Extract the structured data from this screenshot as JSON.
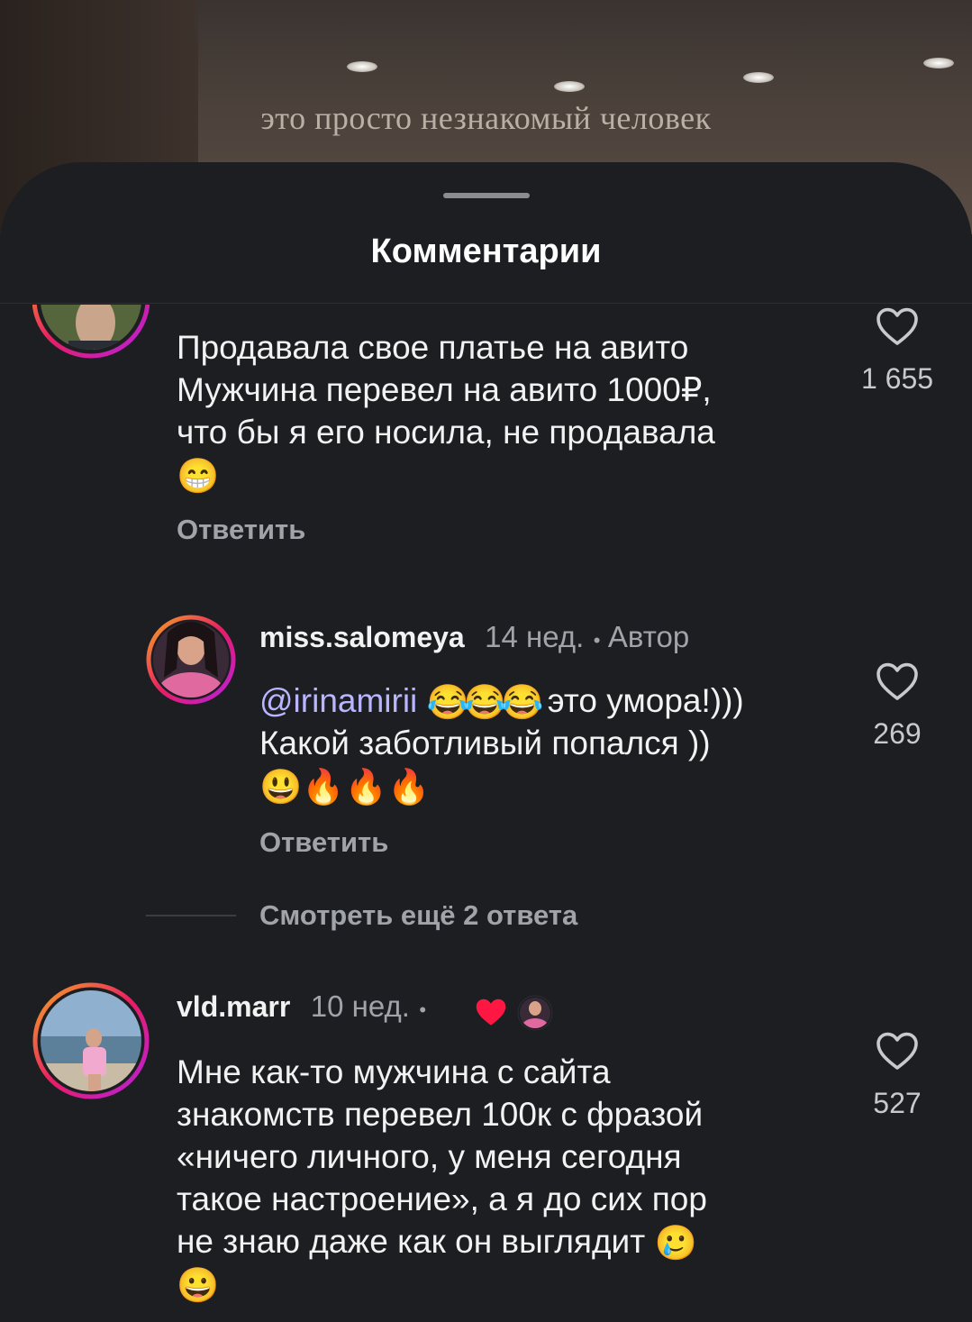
{
  "video": {
    "overlay_text": "это просто незнакомый человек"
  },
  "sheet": {
    "title": "Комментарии"
  },
  "comments": [
    {
      "text_lines": [
        "Продавала свое платье на авито",
        "Мужчина перевел на авито 1000₽,",
        "что бы я его носила, не продавала"
      ],
      "emoji_line": "😁",
      "likes": "1 655",
      "reply_label": "Ответить"
    },
    {
      "username": "miss.salomeya",
      "time": "14 нед.",
      "dot": "•",
      "author_badge": "Автор",
      "mention": "@irinamirii",
      "line1_emojis": "😂😂😂",
      "line1_text": "это умора!)))",
      "line2": "Какой заботливый попался ))",
      "line3_emojis": "😃🔥🔥🔥",
      "likes": "269",
      "reply_label": "Ответить"
    },
    {
      "username": "vld.marr",
      "time": "10 нед.",
      "dot": "•",
      "text_lines": [
        "Мне как-то мужчина с сайта",
        "знакомств перевел 100к с фразой",
        "«ничего личного, у меня сегодня",
        "такое настроение», а я до сих пор"
      ],
      "last_line_text": "не знаю даже как он выглядит",
      "last_line_emoji": "🥲",
      "final_emoji": "😀",
      "likes": "527"
    }
  ],
  "view_more": {
    "label": "Смотреть ещё 2 ответа"
  },
  "icons": [
    "heart-outline-icon",
    "red-heart-icon",
    "drag-handle-icon"
  ],
  "colors": {
    "background": "#1c1e22",
    "text": "#f2f2f2",
    "muted": "#a0a3a8",
    "mention": "#b9b5ff",
    "heart_red": "#ff1744"
  }
}
